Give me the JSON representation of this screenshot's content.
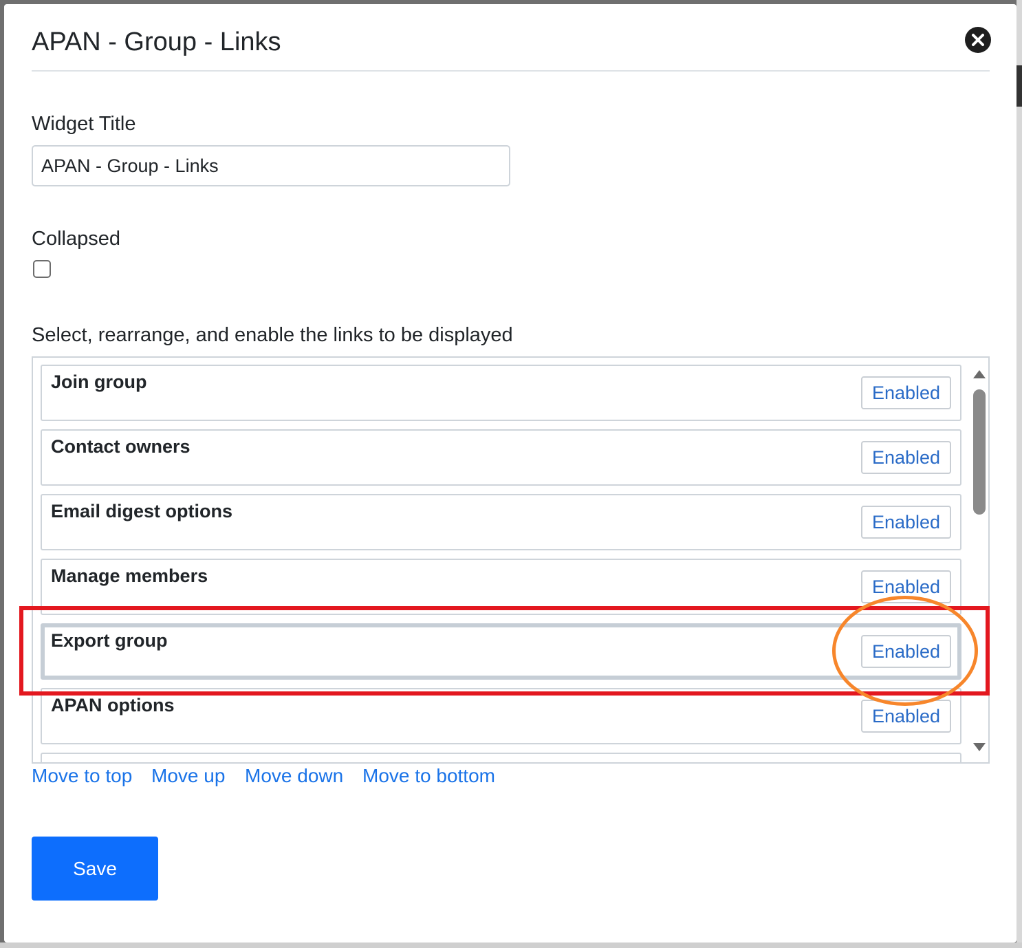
{
  "dialog": {
    "title": "APAN - Group - Links",
    "close_icon": "close-circle-icon"
  },
  "form": {
    "widget_title_label": "Widget Title",
    "widget_title_value": "APAN - Group - Links",
    "collapsed_label": "Collapsed",
    "collapsed_checked": false,
    "links_instruction": "Select, rearrange, and enable the links to be displayed"
  },
  "links": [
    {
      "name": "Join group",
      "status": "Enabled"
    },
    {
      "name": "Contact owners",
      "status": "Enabled"
    },
    {
      "name": "Email digest options",
      "status": "Enabled"
    },
    {
      "name": "Manage members",
      "status": "Enabled"
    },
    {
      "name": "Export group",
      "status": "Enabled",
      "selected": true
    },
    {
      "name": "APAN options",
      "status": "Enabled"
    }
  ],
  "actions": {
    "move_to_top": "Move to top",
    "move_up": "Move up",
    "move_down": "Move down",
    "move_to_bottom": "Move to bottom"
  },
  "footer": {
    "save_label": "Save"
  },
  "colors": {
    "primary": "#0d6efd",
    "link": "#1a73e8",
    "annotation_red": "#e3181f",
    "annotation_orange": "#f7862b"
  }
}
